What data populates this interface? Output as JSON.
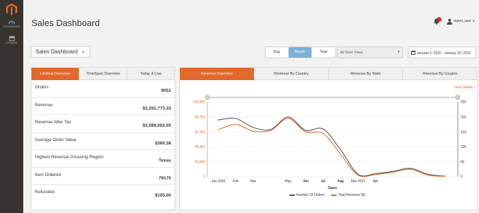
{
  "app": {
    "colors": {
      "accent": "#e2682c",
      "active_period": "#7ab1d6",
      "sidebar": "#373330"
    }
  },
  "sidebar": {
    "items": [
      {
        "label": "DASHBOARD",
        "icon": "dashboard-icon"
      },
      {
        "label": "STORES",
        "icon": "stores-icon"
      }
    ]
  },
  "header": {
    "title": "Sales Dashboard",
    "user": "report_user"
  },
  "toolbar": {
    "dashboard_select": "Sales Dashboard",
    "periods": [
      "Day",
      "Month",
      "Year"
    ],
    "active_period": "Month",
    "store_view": "All Store Views",
    "date_range": "January 1, 2020 - January 20, 2022"
  },
  "stats": {
    "tabs": [
      "Lifetime Overview",
      "TimeSpan Overview",
      "Today & Live"
    ],
    "active_tab": "Lifetime Overview",
    "rows": [
      {
        "label": "Orders",
        "value": "9051"
      },
      {
        "label": "Revenue",
        "value": "$3,261,773.33"
      },
      {
        "label": "Revenue After Tax",
        "value": "$3,089,002.05"
      },
      {
        "label": "Average Order Value",
        "value": "$360.38"
      },
      {
        "label": "Highest Revenue Grossing Region",
        "value": "Texas"
      },
      {
        "label": "Item Ordered",
        "value": "79170"
      },
      {
        "label": "Refunded",
        "value": "$105.00"
      }
    ]
  },
  "chart_panel": {
    "tabs": [
      "Revenue Overview",
      "Revenue By Country",
      "Revenue By State",
      "Revenue By Coupon"
    ],
    "active_tab": "Revenue Overview",
    "view_details": "View Details ›"
  },
  "chart_data": {
    "type": "line",
    "x": [
      "Jan 2020",
      "Feb",
      "Mar",
      "Apr",
      "May",
      "Jun",
      "Jul",
      "Aug",
      "Mar 2021",
      "Apr",
      "May",
      "Jun",
      "Jul",
      "Aug"
    ],
    "x_ticks": [
      "Jan 2020",
      "Feb",
      "Mar",
      "Apr",
      "May",
      "Jun",
      "Jul",
      "Aug",
      "Mar 2021",
      "Jun",
      "Jul",
      "Aug"
    ],
    "xlabel": "Dates",
    "y_left": {
      "ticks": [
        "0",
        "20,000",
        "40,000",
        "60,000",
        "80,000",
        "100,000"
      ],
      "ylim": [
        0,
        100000
      ]
    },
    "y_right": {
      "ticks": [
        "0",
        "50",
        "100",
        "150",
        "200",
        "250"
      ],
      "ylim": [
        0,
        250
      ]
    },
    "series": [
      {
        "name": "Number Of Orders",
        "axis": "right",
        "color": "#555555",
        "values": [
          190,
          195,
          165,
          158,
          200,
          155,
          160,
          90,
          8,
          10,
          18,
          28,
          8,
          2
        ]
      },
      {
        "name": "Total Revenue ($)",
        "axis": "left",
        "color": "#e2682c",
        "values": [
          63000,
          70000,
          61000,
          62000,
          78000,
          60000,
          58000,
          30000,
          2000,
          3000,
          6000,
          10000,
          2000,
          500
        ]
      }
    ]
  }
}
